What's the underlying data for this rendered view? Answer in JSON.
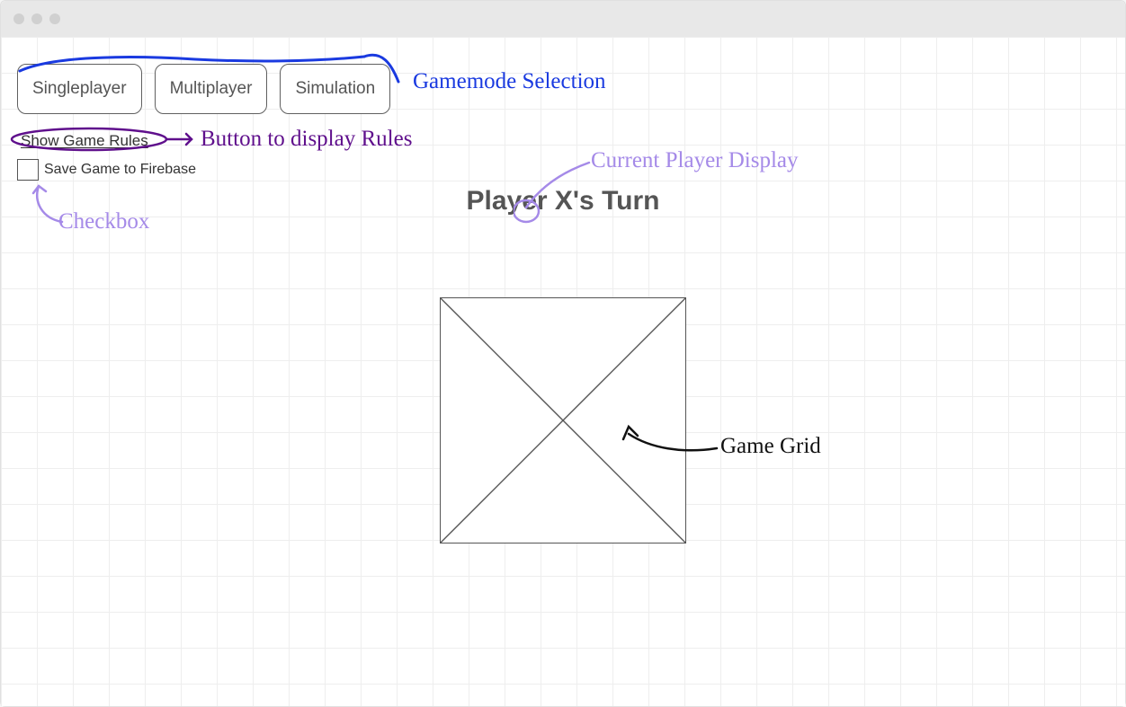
{
  "tabs": {
    "singleplayer": "Singleplayer",
    "multiplayer": "Multiplayer",
    "simulation": "Simulation"
  },
  "rulesButton": "Show Game Rules",
  "saveCheckbox": {
    "label": "Save Game to Firebase",
    "checked": false
  },
  "turnDisplay": "Player X's Turn",
  "annotations": {
    "gamemode": "Gamemode Selection",
    "rules": "Button to display Rules",
    "current": "Current Player Display",
    "checkbox": "Checkbox",
    "grid": "Game Grid"
  }
}
